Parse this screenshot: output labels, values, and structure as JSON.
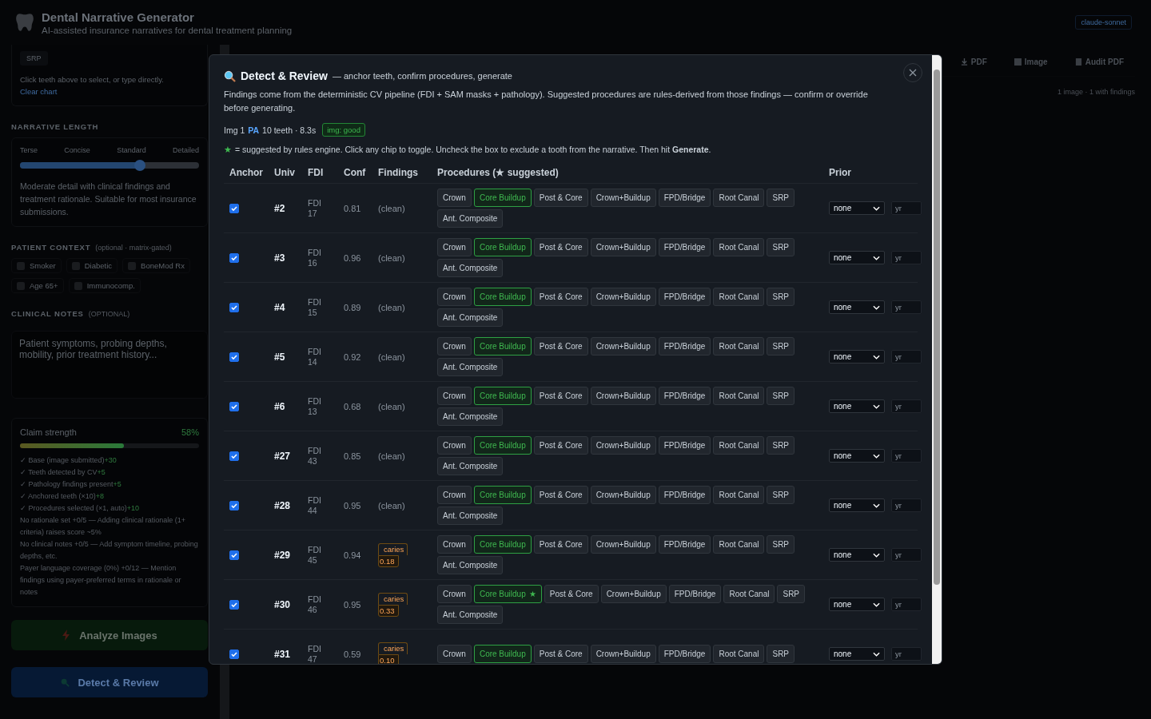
{
  "header": {
    "title": "Dental Narrative Generator",
    "subtitle": "AI-assisted insurance narratives for dental treatment planning",
    "model": "claude-sonnet"
  },
  "sidebar": {
    "chips": [
      "SRP"
    ],
    "help": "Click teeth above to select, or type directly.",
    "help_link": "Clear chart",
    "narrative_length": {
      "heading": "NARRATIVE LENGTH",
      "labels": [
        "Terse",
        "Concise",
        "Standard",
        "Detailed"
      ],
      "level": 0.67,
      "description": "Moderate detail with clinical findings and treatment rationale. Suitable for most insurance submissions."
    },
    "patient_context": {
      "heading": "PATIENT CONTEXT",
      "note": "(optional · matrix-gated)",
      "options": [
        {
          "label": "Smoker",
          "checked": false
        },
        {
          "label": "Diabetic",
          "checked": false
        },
        {
          "label": "BoneMod Rx",
          "checked": false
        },
        {
          "label": "Age 65+",
          "checked": false
        },
        {
          "label": "Immunocomp.",
          "checked": false
        }
      ]
    },
    "clinical_notes": {
      "heading": "CLINICAL NOTES",
      "note": "(OPTIONAL)",
      "placeholder": "Patient symptoms, probing depths, mobility, prior treatment history..."
    },
    "claim": {
      "label": "Claim strength",
      "value": "58%",
      "level": 0.58,
      "items": [
        {
          "text": "✓ Base (image submitted)",
          "points": "+30"
        },
        {
          "text": "✓ Teeth detected by CV",
          "points": "+5"
        },
        {
          "text": "✓ Pathology findings present",
          "points": "+5"
        },
        {
          "text": "✓ Anchored teeth (×10)",
          "points": "+8"
        },
        {
          "text": "✓ Procedures selected (×1, auto)",
          "points": "+10"
        },
        {
          "text": "No rationale set +0/5 — Adding clinical rationale (1+ criteria) raises score ~5%"
        },
        {
          "text": "No clinical notes +0/5 — Add symptom timeline, probing depths, etc."
        },
        {
          "text": "Payer language coverage (0%) +0/12 — Mention findings using payer-preferred terms in rationale or notes"
        }
      ]
    },
    "analyze_button": "Analyze Images",
    "detect_button": "Detect & Review"
  },
  "toolbar": {
    "buttons": [
      {
        "kind": "download",
        "label": "PDF"
      },
      {
        "kind": "image",
        "label": "Image"
      },
      {
        "kind": "audit",
        "label": "Audit PDF"
      }
    ],
    "summary": "1 image · 1 with findings"
  },
  "modal": {
    "title": "Detect & Review",
    "subtitle": "— anchor teeth, confirm procedures, generate",
    "intro": "Findings come from the deterministic CV pipeline (FDI + SAM masks + pathology). Suggested procedures are rules-derived from those findings — confirm or override before generating.",
    "meta": {
      "img": "Img 1",
      "modality": "PA",
      "info": "10 teeth · 8.3s",
      "quality": "img: good"
    },
    "legend": {
      "star": "★",
      "text": "= suggested by rules engine. Click any chip to toggle. Uncheck the box to exclude a tooth from the narrative. Then hit **Generate**."
    },
    "columns": [
      "Anchor",
      "Univ",
      "FDI",
      "Conf",
      "Findings",
      "Procedures (★ suggested)",
      "Prior"
    ],
    "rows": [
      {
        "anchor": true,
        "univ": "#2",
        "fdi_label": "FDI",
        "fdi": "17",
        "conf": "0.81",
        "finding": {
          "kind": "clean",
          "text": "(clean)"
        },
        "procedures": [
          {
            "label": "Crown",
            "selected": false
          },
          {
            "label": "Core Buildup",
            "selected": true
          },
          {
            "label": "Post & Core",
            "selected": false
          },
          {
            "label": "Crown+Buildup",
            "selected": false
          },
          {
            "label": "FPD/Bridge",
            "selected": false
          },
          {
            "label": "Root Canal",
            "selected": false
          },
          {
            "label": "SRP",
            "selected": false
          },
          {
            "label": "Ant. Composite",
            "selected": false
          }
        ],
        "prior": {
          "value": "none",
          "placeholder": "yr"
        }
      },
      {
        "anchor": true,
        "univ": "#3",
        "fdi_label": "FDI",
        "fdi": "16",
        "conf": "0.96",
        "finding": {
          "kind": "clean",
          "text": "(clean)"
        },
        "procedures": [
          {
            "label": "Crown",
            "selected": false
          },
          {
            "label": "Core Buildup",
            "selected": true
          },
          {
            "label": "Post & Core",
            "selected": false
          },
          {
            "label": "Crown+Buildup",
            "selected": false
          },
          {
            "label": "FPD/Bridge",
            "selected": false
          },
          {
            "label": "Root Canal",
            "selected": false
          },
          {
            "label": "SRP",
            "selected": false
          },
          {
            "label": "Ant. Composite",
            "selected": false
          }
        ],
        "prior": {
          "value": "none",
          "placeholder": "yr"
        }
      },
      {
        "anchor": true,
        "univ": "#4",
        "fdi_label": "FDI",
        "fdi": "15",
        "conf": "0.89",
        "finding": {
          "kind": "clean",
          "text": "(clean)"
        },
        "procedures": [
          {
            "label": "Crown",
            "selected": false
          },
          {
            "label": "Core Buildup",
            "selected": true
          },
          {
            "label": "Post & Core",
            "selected": false
          },
          {
            "label": "Crown+Buildup",
            "selected": false
          },
          {
            "label": "FPD/Bridge",
            "selected": false
          },
          {
            "label": "Root Canal",
            "selected": false
          },
          {
            "label": "SRP",
            "selected": false
          },
          {
            "label": "Ant. Composite",
            "selected": false
          }
        ],
        "prior": {
          "value": "none",
          "placeholder": "yr"
        }
      },
      {
        "anchor": true,
        "univ": "#5",
        "fdi_label": "FDI",
        "fdi": "14",
        "conf": "0.92",
        "finding": {
          "kind": "clean",
          "text": "(clean)"
        },
        "procedures": [
          {
            "label": "Crown",
            "selected": false
          },
          {
            "label": "Core Buildup",
            "selected": true
          },
          {
            "label": "Post & Core",
            "selected": false
          },
          {
            "label": "Crown+Buildup",
            "selected": false
          },
          {
            "label": "FPD/Bridge",
            "selected": false
          },
          {
            "label": "Root Canal",
            "selected": false
          },
          {
            "label": "SRP",
            "selected": false
          },
          {
            "label": "Ant. Composite",
            "selected": false
          }
        ],
        "prior": {
          "value": "none",
          "placeholder": "yr"
        }
      },
      {
        "anchor": true,
        "univ": "#6",
        "fdi_label": "FDI",
        "fdi": "13",
        "conf": "0.68",
        "finding": {
          "kind": "clean",
          "text": "(clean)"
        },
        "procedures": [
          {
            "label": "Crown",
            "selected": false
          },
          {
            "label": "Core Buildup",
            "selected": true
          },
          {
            "label": "Post & Core",
            "selected": false
          },
          {
            "label": "Crown+Buildup",
            "selected": false
          },
          {
            "label": "FPD/Bridge",
            "selected": false
          },
          {
            "label": "Root Canal",
            "selected": false
          },
          {
            "label": "SRP",
            "selected": false
          },
          {
            "label": "Ant. Composite",
            "selected": false
          }
        ],
        "prior": {
          "value": "none",
          "placeholder": "yr"
        }
      },
      {
        "anchor": true,
        "univ": "#27",
        "fdi_label": "FDI",
        "fdi": "43",
        "conf": "0.85",
        "finding": {
          "kind": "clean",
          "text": "(clean)"
        },
        "procedures": [
          {
            "label": "Crown",
            "selected": false
          },
          {
            "label": "Core Buildup",
            "selected": true
          },
          {
            "label": "Post & Core",
            "selected": false
          },
          {
            "label": "Crown+Buildup",
            "selected": false
          },
          {
            "label": "FPD/Bridge",
            "selected": false
          },
          {
            "label": "Root Canal",
            "selected": false
          },
          {
            "label": "SRP",
            "selected": false
          },
          {
            "label": "Ant. Composite",
            "selected": false
          }
        ],
        "prior": {
          "value": "none",
          "placeholder": "yr"
        }
      },
      {
        "anchor": true,
        "univ": "#28",
        "fdi_label": "FDI",
        "fdi": "44",
        "conf": "0.95",
        "finding": {
          "kind": "clean",
          "text": "(clean)"
        },
        "procedures": [
          {
            "label": "Crown",
            "selected": false
          },
          {
            "label": "Core Buildup",
            "selected": true
          },
          {
            "label": "Post & Core",
            "selected": false
          },
          {
            "label": "Crown+Buildup",
            "selected": false
          },
          {
            "label": "FPD/Bridge",
            "selected": false
          },
          {
            "label": "Root Canal",
            "selected": false
          },
          {
            "label": "SRP",
            "selected": false
          },
          {
            "label": "Ant. Composite",
            "selected": false
          }
        ],
        "prior": {
          "value": "none",
          "placeholder": "yr"
        }
      },
      {
        "anchor": true,
        "univ": "#29",
        "fdi_label": "FDI",
        "fdi": "45",
        "conf": "0.94",
        "finding": {
          "kind": "tag",
          "label": "caries",
          "score": "0.18"
        },
        "procedures": [
          {
            "label": "Crown",
            "selected": false
          },
          {
            "label": "Core Buildup",
            "selected": true
          },
          {
            "label": "Post & Core",
            "selected": false
          },
          {
            "label": "Crown+Buildup",
            "selected": false
          },
          {
            "label": "FPD/Bridge",
            "selected": false
          },
          {
            "label": "Root Canal",
            "selected": false
          },
          {
            "label": "SRP",
            "selected": false
          },
          {
            "label": "Ant. Composite",
            "selected": false
          }
        ],
        "prior": {
          "value": "none",
          "placeholder": "yr"
        }
      },
      {
        "anchor": true,
        "univ": "#30",
        "fdi_label": "FDI",
        "fdi": "46",
        "conf": "0.95",
        "finding": {
          "kind": "tag",
          "label": "caries",
          "score": "0.33"
        },
        "procedures": [
          {
            "label": "Crown",
            "selected": false
          },
          {
            "label": "Core Buildup",
            "selected": true,
            "star": "★"
          },
          {
            "label": "Post & Core",
            "selected": false
          },
          {
            "label": "Crown+Buildup",
            "selected": false
          },
          {
            "label": "FPD/Bridge",
            "selected": false
          },
          {
            "label": "Root Canal",
            "selected": false
          },
          {
            "label": "SRP",
            "selected": false
          },
          {
            "label": "Ant. Composite",
            "selected": false
          }
        ],
        "prior": {
          "value": "none",
          "placeholder": "yr"
        }
      },
      {
        "anchor": true,
        "univ": "#31",
        "fdi_label": "FDI",
        "fdi": "47",
        "conf": "0.59",
        "finding": {
          "kind": "tag",
          "label": "caries",
          "score": "0.10"
        },
        "procedures": [
          {
            "label": "Crown",
            "selected": false
          },
          {
            "label": "Core Buildup",
            "selected": true
          },
          {
            "label": "Post & Core",
            "selected": false
          },
          {
            "label": "Crown+Buildup",
            "selected": false
          },
          {
            "label": "FPD/Bridge",
            "selected": false
          },
          {
            "label": "Root Canal",
            "selected": false
          },
          {
            "label": "SRP",
            "selected": false
          }
        ],
        "prior": {
          "value": "none",
          "placeholder": "yr"
        }
      }
    ]
  }
}
